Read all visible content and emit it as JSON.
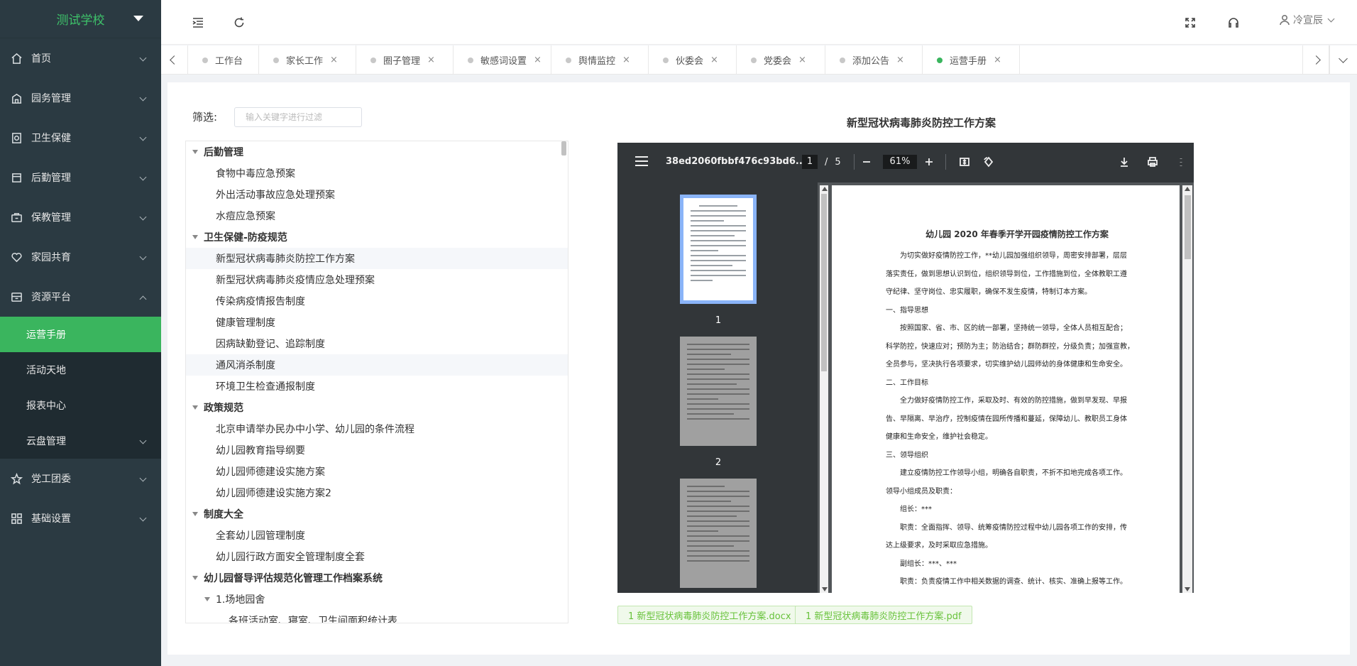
{
  "sidebar": {
    "brand": "测试学校",
    "menu": [
      {
        "label": "首页"
      },
      {
        "label": "园务管理"
      },
      {
        "label": "卫生保健"
      },
      {
        "label": "后勤管理"
      },
      {
        "label": "保教管理"
      },
      {
        "label": "家园共育"
      },
      {
        "label": "资源平台"
      }
    ],
    "submenu": [
      {
        "label": "运营手册"
      },
      {
        "label": "活动天地"
      },
      {
        "label": "报表中心"
      },
      {
        "label": "云盘管理"
      }
    ],
    "menu_after": [
      {
        "label": "党工团委"
      },
      {
        "label": "基础设置"
      }
    ]
  },
  "topbar": {
    "user": "冷宣辰"
  },
  "tabs": [
    {
      "label": "工作台"
    },
    {
      "label": "家长工作",
      "close": "×"
    },
    {
      "label": "圈子管理",
      "close": "×"
    },
    {
      "label": "敏感词设置",
      "close": "×"
    },
    {
      "label": "舆情监控",
      "close": "×"
    },
    {
      "label": "伙委会",
      "close": "×"
    },
    {
      "label": "党委会",
      "close": "×"
    },
    {
      "label": "添加公告",
      "close": "×"
    },
    {
      "label": "运营手册",
      "close": "×"
    }
  ],
  "filter": {
    "label": "筛选:",
    "placeholder": "输入关键字进行过滤"
  },
  "tree": [
    {
      "type": "group",
      "label": "后勤管理"
    },
    {
      "type": "child",
      "label": "食物中毒应急预案"
    },
    {
      "type": "child",
      "label": "外出活动事故应急处理预案"
    },
    {
      "type": "child",
      "label": "水痘应急预案"
    },
    {
      "type": "group",
      "label": "卫生保健-防疫规范"
    },
    {
      "type": "child",
      "label": "新型冠状病毒肺炎防控工作方案"
    },
    {
      "type": "child",
      "label": "新型冠状病毒肺炎疫情应急处理预案"
    },
    {
      "type": "child",
      "label": "传染病疫情报告制度"
    },
    {
      "type": "child",
      "label": "健康管理制度"
    },
    {
      "type": "child",
      "label": "因病缺勤登记、追踪制度"
    },
    {
      "type": "child",
      "label": "通风消杀制度"
    },
    {
      "type": "child",
      "label": "环境卫生检查通报制度"
    },
    {
      "type": "group",
      "label": "政策规范"
    },
    {
      "type": "child",
      "label": "北京申请举办民办中小学、幼儿园的条件流程"
    },
    {
      "type": "child",
      "label": "幼儿园教育指导纲要"
    },
    {
      "type": "child",
      "label": "幼儿园师德建设实施方案"
    },
    {
      "type": "child",
      "label": "幼儿园师德建设实施方案2"
    },
    {
      "type": "group",
      "label": "制度大全"
    },
    {
      "type": "child",
      "label": "全套幼儿园管理制度"
    },
    {
      "type": "child",
      "label": "幼儿园行政方面安全管理制度全套"
    },
    {
      "type": "group",
      "label": "幼儿园督导评估规范化管理工作档案系统"
    },
    {
      "type": "child2",
      "label": "1.场地园舍"
    },
    {
      "type": "child3",
      "label": "各班活动室、寝室、卫生间面积统计表"
    }
  ],
  "document": {
    "title": "新型冠状病毒肺炎防控工作方案",
    "pdf": {
      "filename": "38ed2060fbbf476c93bd6...",
      "page": "1",
      "pages": "5",
      "zoom": "61%",
      "thumb_labels": [
        "1",
        "2"
      ],
      "heading": "幼儿园 2020 年春季开学开园疫情防控工作方案",
      "lines": [
        "为切实做好疫情防控工作，**幼儿园加强组织领导，周密安排部署，层层",
        "落实责任，做到思想认识到位，组织领导到位，工作措施到位，全体教职工遵",
        "守纪律、坚守岗位、忠实履职，确保不发生疫情，特制订本方案。",
        "一、指导思想",
        "按照国家、省、市、区的统一部署，坚持统一领导，全体人员相互配合；",
        "科学防控，快速应对；预防为主；防治结合；群防群控，分级负责；加强宣教，",
        "全员参与，坚决执行各项要求，切实维护幼儿园师幼的身体健康和生命安全。",
        "二、工作目标",
        "全力做好疫情防控工作，采取及时、有效的防控措施，做到早发现、早报",
        "告、早隔离、早治疗，控制疫情在园所传播和蔓延，保障幼儿、教职员工身体",
        "健康和生命安全，维护社会稳定。",
        "三、领导组织",
        "建立疫情防控工作领导小组，明确各自职责，不折不扣地完成各项工作。",
        "领导小组成员及职责：",
        "组长：***",
        "职责：全面指挥、领导、统筹疫情防控过程中幼儿园各项工作的安排，传",
        "达上级要求，及时采取应急措施。",
        "副组长：***、***",
        "职责：负责疫情工作中相关数据的调查、统计、核实、准确上报等工作。"
      ]
    },
    "attachments": [
      "1 新型冠状病毒肺炎防控工作方案.docx",
      "1 新型冠状病毒肺炎防控工作方案.pdf"
    ]
  }
}
